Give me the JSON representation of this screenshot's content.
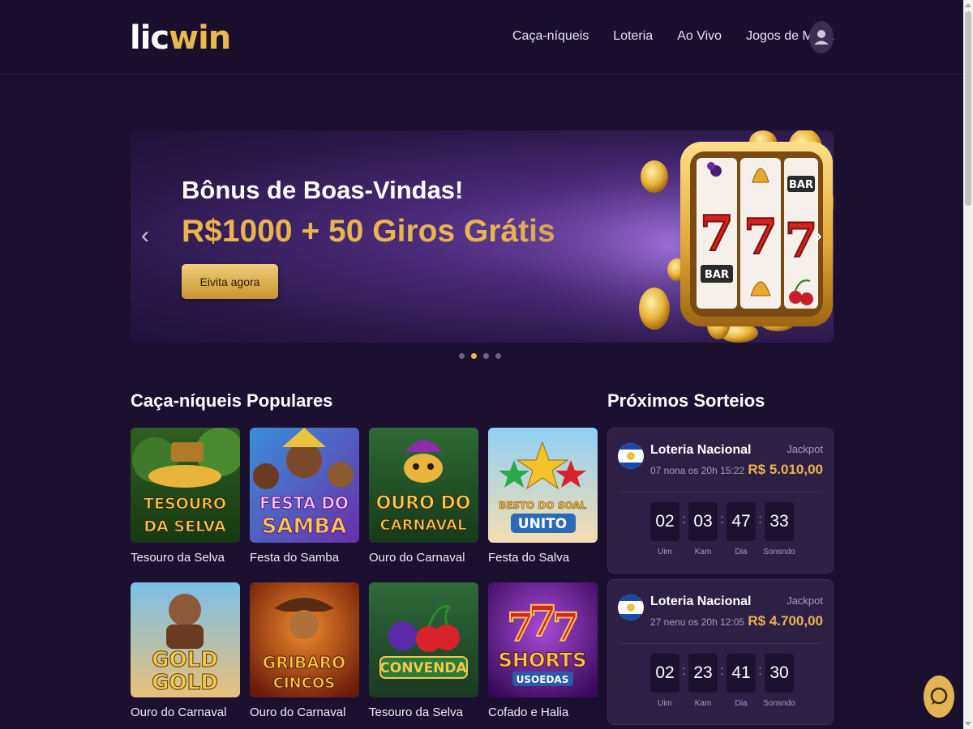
{
  "logo": {
    "part1": "lic",
    "part2": "win"
  },
  "nav": [
    {
      "label": "Caça-níqueis"
    },
    {
      "label": "Loteria"
    },
    {
      "label": "Ao Vivo"
    },
    {
      "label": "Jogos de Mesa"
    }
  ],
  "banner": {
    "title": "Bônus de Boas-Vindas!",
    "subtitle": "R$1000 + 50 Giros Grátis",
    "cta": "Eivita agora",
    "slide_count": 4,
    "active_slide": 2,
    "reel_symbols": [
      "BAR",
      "BAR"
    ]
  },
  "popular": {
    "title": "Caça-níqueis Populares",
    "games": [
      {
        "name": "Tesouro da Selva",
        "art_text": [
          "TESOURO",
          "DA SELVA"
        ]
      },
      {
        "name": "Festa do Samba",
        "art_text": [
          "FESTA DO",
          "SAMBA"
        ]
      },
      {
        "name": "Ouro do Carnaval",
        "art_text": [
          "OURO DO",
          "CARNAVAL"
        ]
      },
      {
        "name": "Festa do Salva",
        "art_text": [
          "BESTO DO SOAL",
          "UNITO"
        ]
      },
      {
        "name": "Ouro do Carnaval",
        "art_text": [
          "GOLD",
          "GOLD"
        ]
      },
      {
        "name": "Ouro do Carnaval",
        "art_text": [
          "GRIBARO",
          "CINCOS"
        ]
      },
      {
        "name": "Tesouro da Selva",
        "art_text": [
          "CONVENDA"
        ]
      },
      {
        "name": "Cofado e Halia",
        "art_text": [
          "SHORTS",
          "USOEDAS"
        ]
      }
    ]
  },
  "draws": {
    "title": "Próximos Sorteios",
    "items": [
      {
        "name": "Loteria Nacional",
        "date": "07 nona os 20h 15:22",
        "jackpot_label": "Jackpot",
        "jackpot": "R$ 5.010,00",
        "countdown": [
          {
            "value": "02",
            "label": "Uim"
          },
          {
            "value": "03",
            "label": "Kam"
          },
          {
            "value": "47",
            "label": "Dia"
          },
          {
            "value": "33",
            "label": "Sonsndo"
          }
        ]
      },
      {
        "name": "Loteria Nacional",
        "date": "27 nenu os 20h 12:05",
        "jackpot_label": "Jackpot",
        "jackpot": "R$ 4.700,00",
        "countdown": [
          {
            "value": "02",
            "label": "Uim"
          },
          {
            "value": "23",
            "label": "Kam"
          },
          {
            "value": "41",
            "label": "Dia"
          },
          {
            "value": "30",
            "label": "Sonsndo"
          }
        ]
      }
    ]
  },
  "colors": {
    "accent": "#e8b44c",
    "background": "#1c1030",
    "card": "#2e2044"
  },
  "icons": {
    "user": "user-icon",
    "chat": "chat-icon",
    "prev": "chevron-left-icon",
    "next": "chevron-right-icon"
  }
}
